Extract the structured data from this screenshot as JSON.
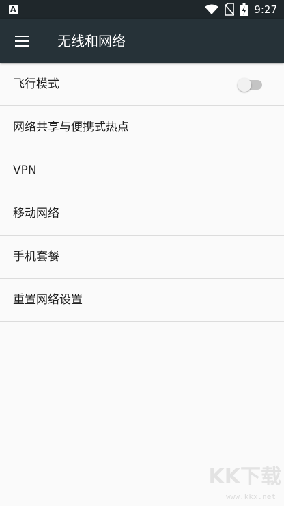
{
  "status_bar": {
    "time": "9:27",
    "icons": [
      "notification-icon",
      "wifi-icon",
      "no-sim-icon",
      "battery-charging-icon"
    ]
  },
  "app_bar": {
    "menu_icon": "menu-icon",
    "title": "无线和网络"
  },
  "settings": [
    {
      "label": "飞行模式",
      "toggle": {
        "checked": false
      }
    },
    {
      "label": "网络共享与便携式热点"
    },
    {
      "label": "VPN"
    },
    {
      "label": "移动网络"
    },
    {
      "label": "手机套餐"
    },
    {
      "label": "重置网络设置"
    }
  ],
  "watermark": {
    "logo": "KK下载",
    "url": "www.kkx.net"
  },
  "colors": {
    "status_bar": "#1f272b",
    "app_bar": "#263238",
    "background": "#fafafa",
    "divider": "#dcdcdc",
    "text": "#212121"
  }
}
